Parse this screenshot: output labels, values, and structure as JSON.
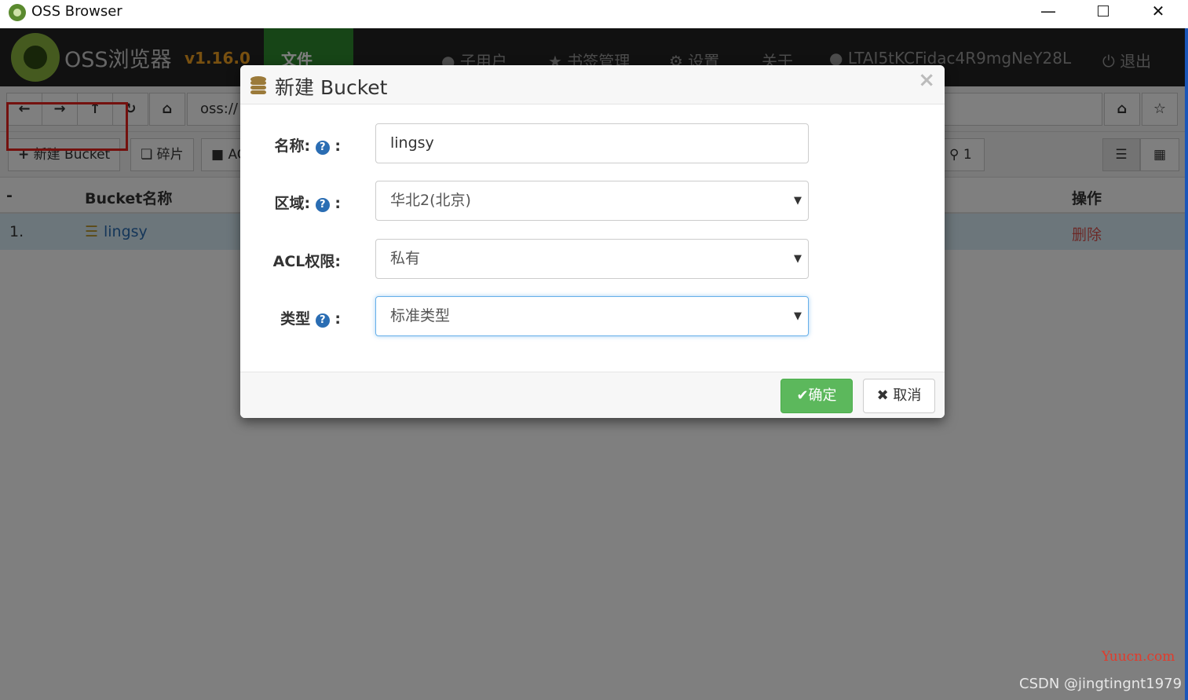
{
  "window": {
    "title": "OSS Browser",
    "minimize": "—",
    "close": "✕"
  },
  "navbar": {
    "brand": "OSS浏览器",
    "version": "v1.16.0",
    "active_tab": "文件",
    "items": {
      "subusers": "子用户",
      "bookmarks": "书签管理",
      "settings": "设置",
      "about": "关于",
      "account": "LTAI5tKCFidac4R9mgNeY28L",
      "logout": "退出"
    }
  },
  "toolbar": {
    "address_prefix": "oss://"
  },
  "actions": {
    "new_bucket": "新建 Bucket",
    "fragments": "碎片",
    "acl_partial": "AC",
    "search_count": "1"
  },
  "table": {
    "headers": {
      "index": "-",
      "name": "Bucket名称",
      "ops": "操作"
    },
    "rows": [
      {
        "index": "1.",
        "name": "lingsy",
        "delete": "删除"
      }
    ]
  },
  "modal": {
    "title": "新建 Bucket",
    "close": "×",
    "fields": {
      "name_label": "名称:",
      "name_value": "lingsy",
      "region_label": "区域:",
      "region_value": "华北2(北京)",
      "acl_label": "ACL权限:",
      "acl_value": "私有",
      "type_label": "类型",
      "type_value": "标准类型"
    },
    "colon": ":",
    "help": "?",
    "ok": "确定",
    "cancel": "取消"
  },
  "watermarks": {
    "site": "Yuucn.com",
    "author": "CSDN @jingtingnt1979"
  },
  "colors": {
    "navbar": "#222222",
    "active_tab": "#2f8a2f",
    "version": "#f0a020",
    "ok": "#5cb85c",
    "highlight": "#e8231d"
  }
}
